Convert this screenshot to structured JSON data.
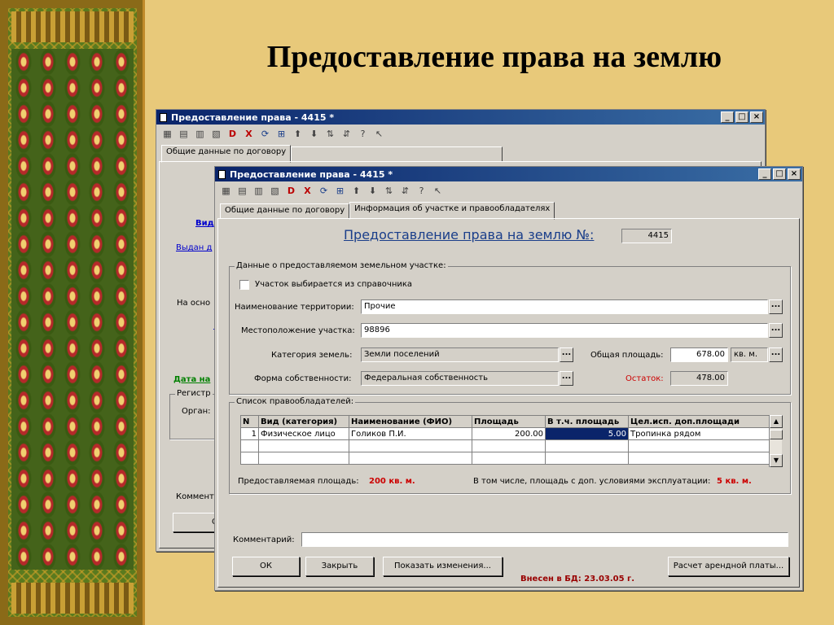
{
  "slide": {
    "title": "Предоставление права на землю"
  },
  "back_window": {
    "title": "Предоставление права - 4415 *",
    "tab_label": "Общие данные по договору",
    "fragments": {
      "vid": "Вид",
      "vydan": "Выдан д",
      "na_osn": "На осно",
      "data_na": "Дата на",
      "registr": "Регистр",
      "organ": "Орган:",
      "komment": "Коммент",
      "ok": "ОК"
    }
  },
  "front_window": {
    "title": "Предоставление права - 4415 *",
    "tabs": [
      "Общие данные по договору",
      "Информация об участке и правообладателях"
    ],
    "heading": "Предоставление права на землю №:",
    "number": "4415",
    "land_group": {
      "caption": "Данные о предоставляемом земельном участке:",
      "checkbox_label": "Участок выбирается из справочника",
      "territory_label": "Наименование территории:",
      "territory_value": "Прочие",
      "location_label": "Местоположение участка:",
      "location_value": "98896",
      "category_label": "Категория земель:",
      "category_value": "Земли поселений",
      "area_label": "Общая площадь:",
      "area_value": "678.00",
      "area_unit": "кв. м.",
      "ownership_label": "Форма собственности:",
      "ownership_value": "Федеральная собственность",
      "remainder_label": "Остаток:",
      "remainder_value": "478.00"
    },
    "owners_group": {
      "caption": "Список правообладателей:",
      "columns": [
        "N",
        "Вид (категория)",
        "Наименование (ФИО)",
        "Площадь",
        "В т.ч. площадь",
        "Цел.исп. доп.площади"
      ],
      "rows": [
        [
          "1",
          "Физическое лицо",
          "Голиков П.И.",
          "200.00",
          "5.00",
          "Тропинка рядом"
        ]
      ],
      "provided_label": "Предоставляемая площадь:",
      "provided_value": "200 кв. м.",
      "extra_label": "В том числе, площадь с доп. условиями эксплуатации:",
      "extra_value": "5 кв. м."
    },
    "comment_label": "Комментарий:",
    "comment_value": "",
    "buttons": {
      "ok": "ОК",
      "close": "Закрыть",
      "changes": "Показать изменения...",
      "rent": "Расчет арендной платы..."
    },
    "db_status": "Внесен в БД: 23.03.05 г."
  },
  "colors": {
    "titlebar": "#0a246a",
    "heading": "#1a3e8a",
    "accent_red": "#cc0000",
    "window_bg": "#d4d0c8"
  }
}
